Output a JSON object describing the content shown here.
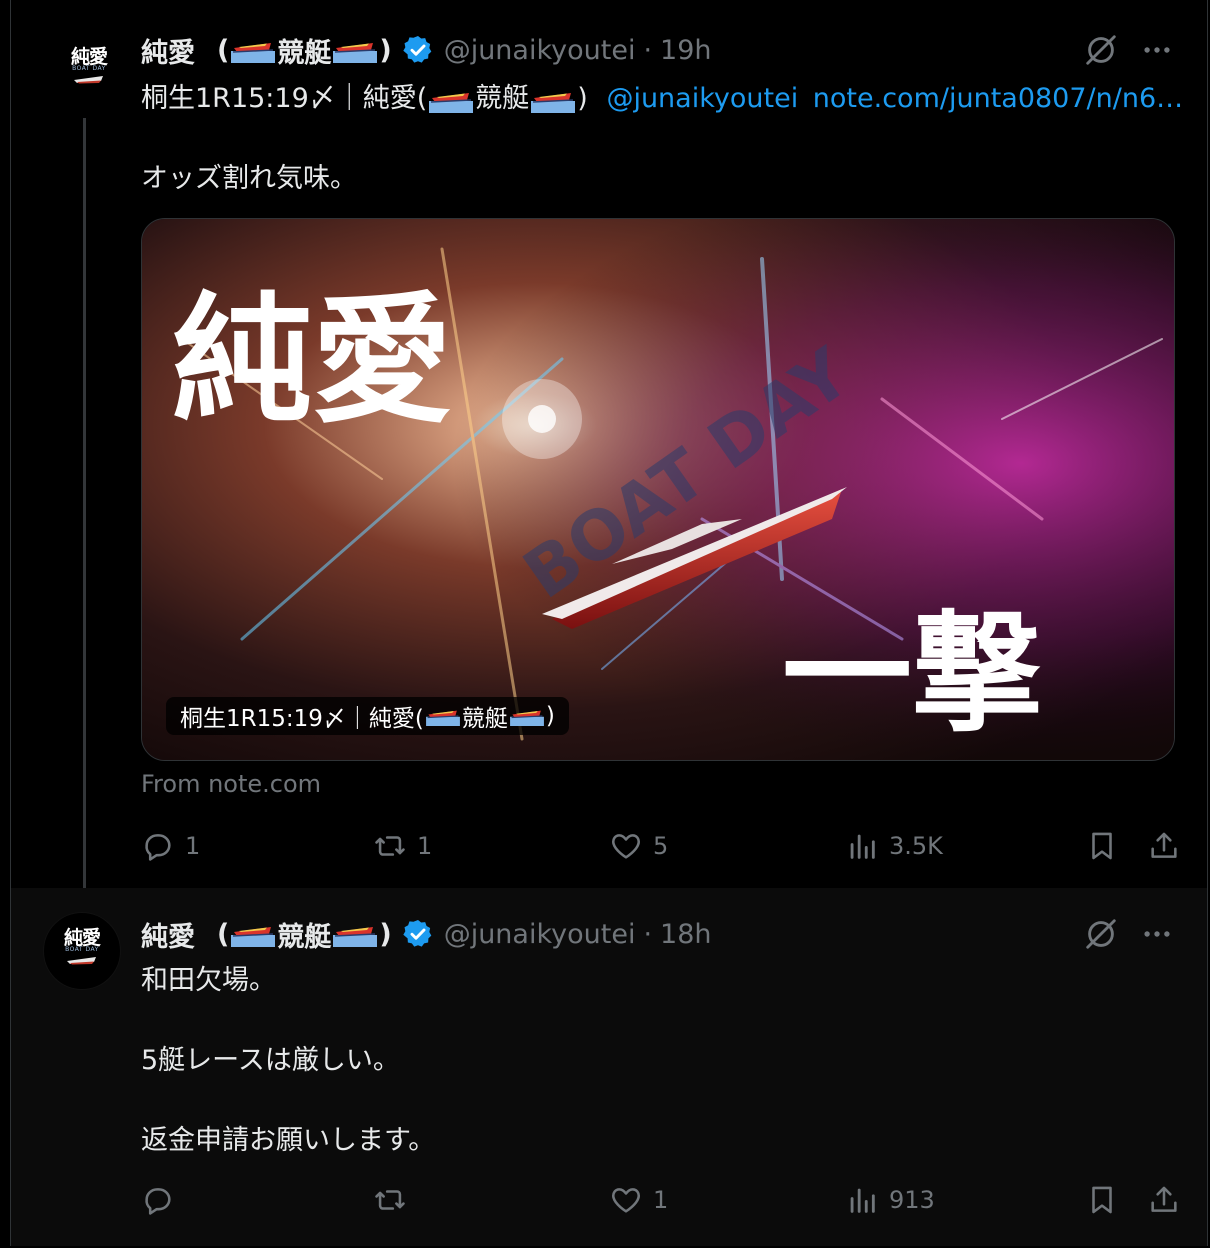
{
  "posts": [
    {
      "author": {
        "display_name": "純愛",
        "display_suffix_left": "(",
        "display_suffix_mid": "競艇",
        "display_suffix_right": ")",
        "handle": "@junaikyoutei",
        "time": "19h",
        "avatar_text": "純愛",
        "avatar_sub": "BOAT DAY"
      },
      "text_line1_prefix": "桐生1R15:19〆｜純愛(",
      "text_line1_mid": "競艇",
      "text_line1_suffix": ")",
      "text_line1_mention": "@junaikyoutei",
      "text_line1_link": "note.com/junta0807/n/n6…",
      "text_line2": "オッズ割れ気味。",
      "card": {
        "title_big": "純愛",
        "title_strike": "一撃",
        "watermark": "BOAT DAY",
        "caption_prefix": "桐生1R15:19〆｜純愛(",
        "caption_mid": "競艇",
        "caption_suffix": ")",
        "source": "From note.com"
      },
      "actions": {
        "replies": "1",
        "reposts": "1",
        "likes": "5",
        "views": "3.5K"
      }
    },
    {
      "author": {
        "display_name": "純愛",
        "display_suffix_left": "(",
        "display_suffix_mid": "競艇",
        "display_suffix_right": ")",
        "handle": "@junaikyoutei",
        "time": "18h",
        "avatar_text": "純愛",
        "avatar_sub": "BOAT DAY"
      },
      "lines": [
        "和田欠場。",
        "5艇レースは厳しい。",
        "返金申請お願いします。"
      ],
      "actions": {
        "replies": "",
        "reposts": "",
        "likes": "1",
        "views": "913"
      }
    }
  ],
  "colors": {
    "background": "#000000",
    "text": "#e7e9ea",
    "muted": "#71767b",
    "link": "#1d9bf0",
    "verified": "#1d9bf0"
  },
  "icons": [
    "verified-badge-icon",
    "grok-icon",
    "more-icon",
    "reply-icon",
    "repost-icon",
    "like-icon",
    "views-icon",
    "bookmark-icon",
    "share-icon",
    "boat-emoji-icon"
  ]
}
